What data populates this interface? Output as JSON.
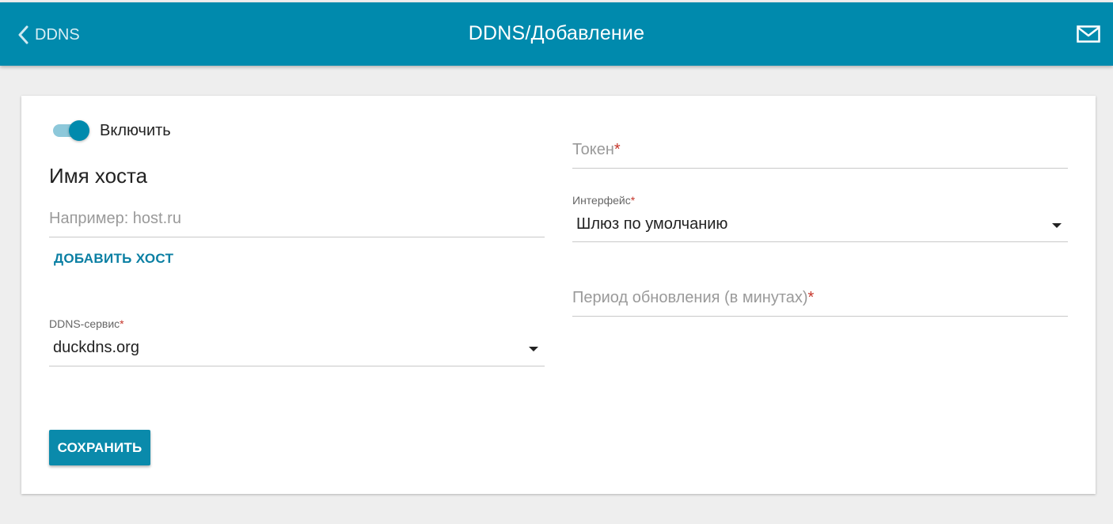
{
  "header": {
    "back_label": "DDNS",
    "title": "DDNS/Добавление",
    "back_icon": "chevron-left-icon",
    "mail_icon": "mail-icon",
    "color": "#008aad"
  },
  "form": {
    "enable_label": "Включить",
    "enabled": true,
    "hostname_title": "Имя хоста",
    "hostname_placeholder": "Например: host.ru",
    "hostname_value": "",
    "add_host_label": "ДОБАВИТЬ ХОСТ",
    "ddns_service_label": "DDNS-сервис",
    "ddns_service_value": "duckdns.org",
    "token_label": "Токен",
    "token_value": "",
    "interface_label": "Интерфейс",
    "interface_value": "Шлюз по умолчанию",
    "period_label": "Период обновления (в минутах)",
    "period_value": "",
    "required_mark": "*",
    "save_label": "СОХРАНИТЬ"
  }
}
